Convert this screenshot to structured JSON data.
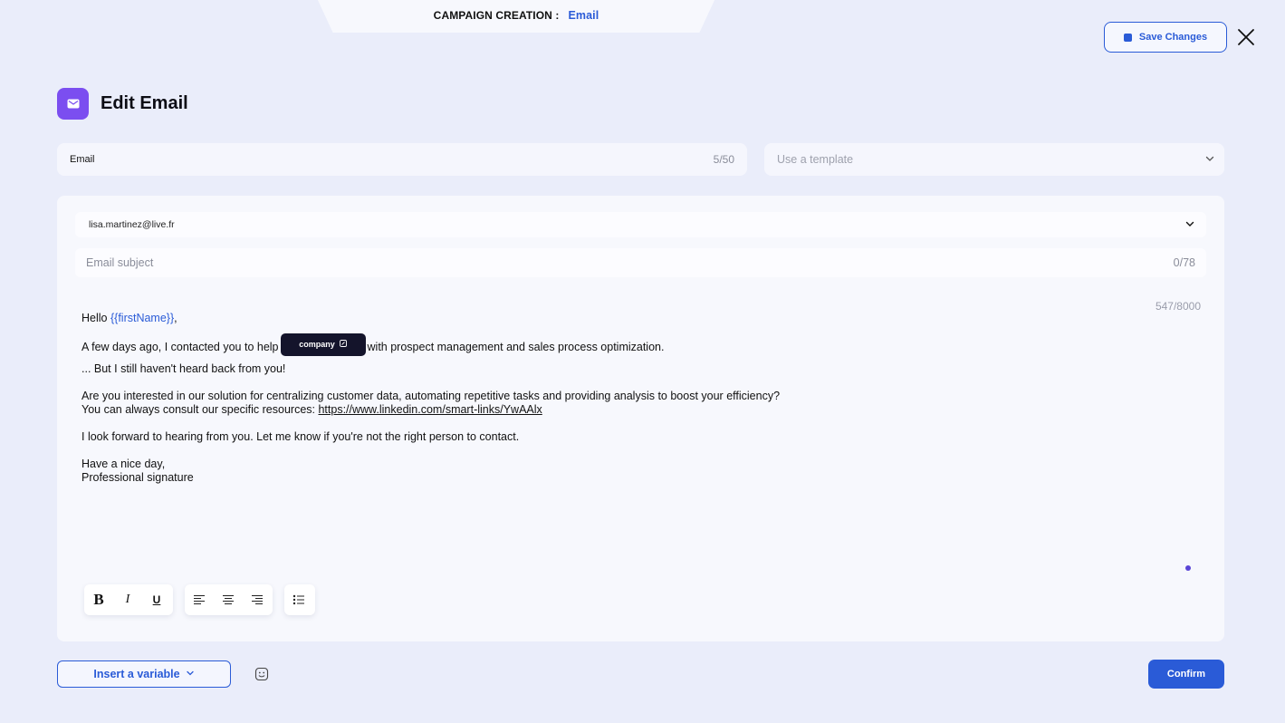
{
  "top_tab": {
    "label": "CAMPAIGN CREATION :",
    "value": "Email"
  },
  "save_button": {
    "label": "Save Changes",
    "icon": "save-icon"
  },
  "close_button": {
    "icon": "close-icon"
  },
  "header": {
    "title": "Edit Email",
    "icon": "mail-icon",
    "badge_color": "#7b4ef0"
  },
  "name_field": {
    "value": "Email",
    "count": "5/50"
  },
  "template_select": {
    "placeholder": "Use a template",
    "icon": "chevron-down-icon"
  },
  "sender_select": {
    "value": "lisa.martinez@live.fr",
    "icon": "chevron-down-icon"
  },
  "subject_field": {
    "placeholder": "Email subject",
    "count": "0/78"
  },
  "body": {
    "count": "547/8000",
    "greeting_prefix": "Hello ",
    "first_name_var": "{{firstName}}",
    "greeting_suffix": ",",
    "line1_prefix": "A few days ago, I contacted you to help",
    "company_chip": "company",
    "line1_suffix": "with prospect management and sales process optimization.",
    "line2": "... But I still haven't heard back from you!",
    "line3": "Are you interested in our solution for centralizing customer data, automating repetitive tasks and providing analysis to boost your efficiency?",
    "line4_prefix": "You can always consult our specific resources: ",
    "line4_link": "https://www.linkedin.com/smart-links/YwAAlx",
    "line5": "I look forward to hearing from you. Let me know if you're not the right person to contact.",
    "line6": "Have a nice day,",
    "line7": "Professional signature"
  },
  "toolbar": {
    "bold": "B",
    "italic": "I",
    "underline": "U"
  },
  "insert_variable": {
    "label": "Insert a variable",
    "icon": "chevron-down-icon"
  },
  "emoji_button": {
    "icon": "emoji-icon"
  },
  "confirm_button": {
    "label": "Confirm"
  },
  "colors": {
    "accent": "#2a5bd7",
    "background": "#eaedfa",
    "chip": "#14142b"
  }
}
